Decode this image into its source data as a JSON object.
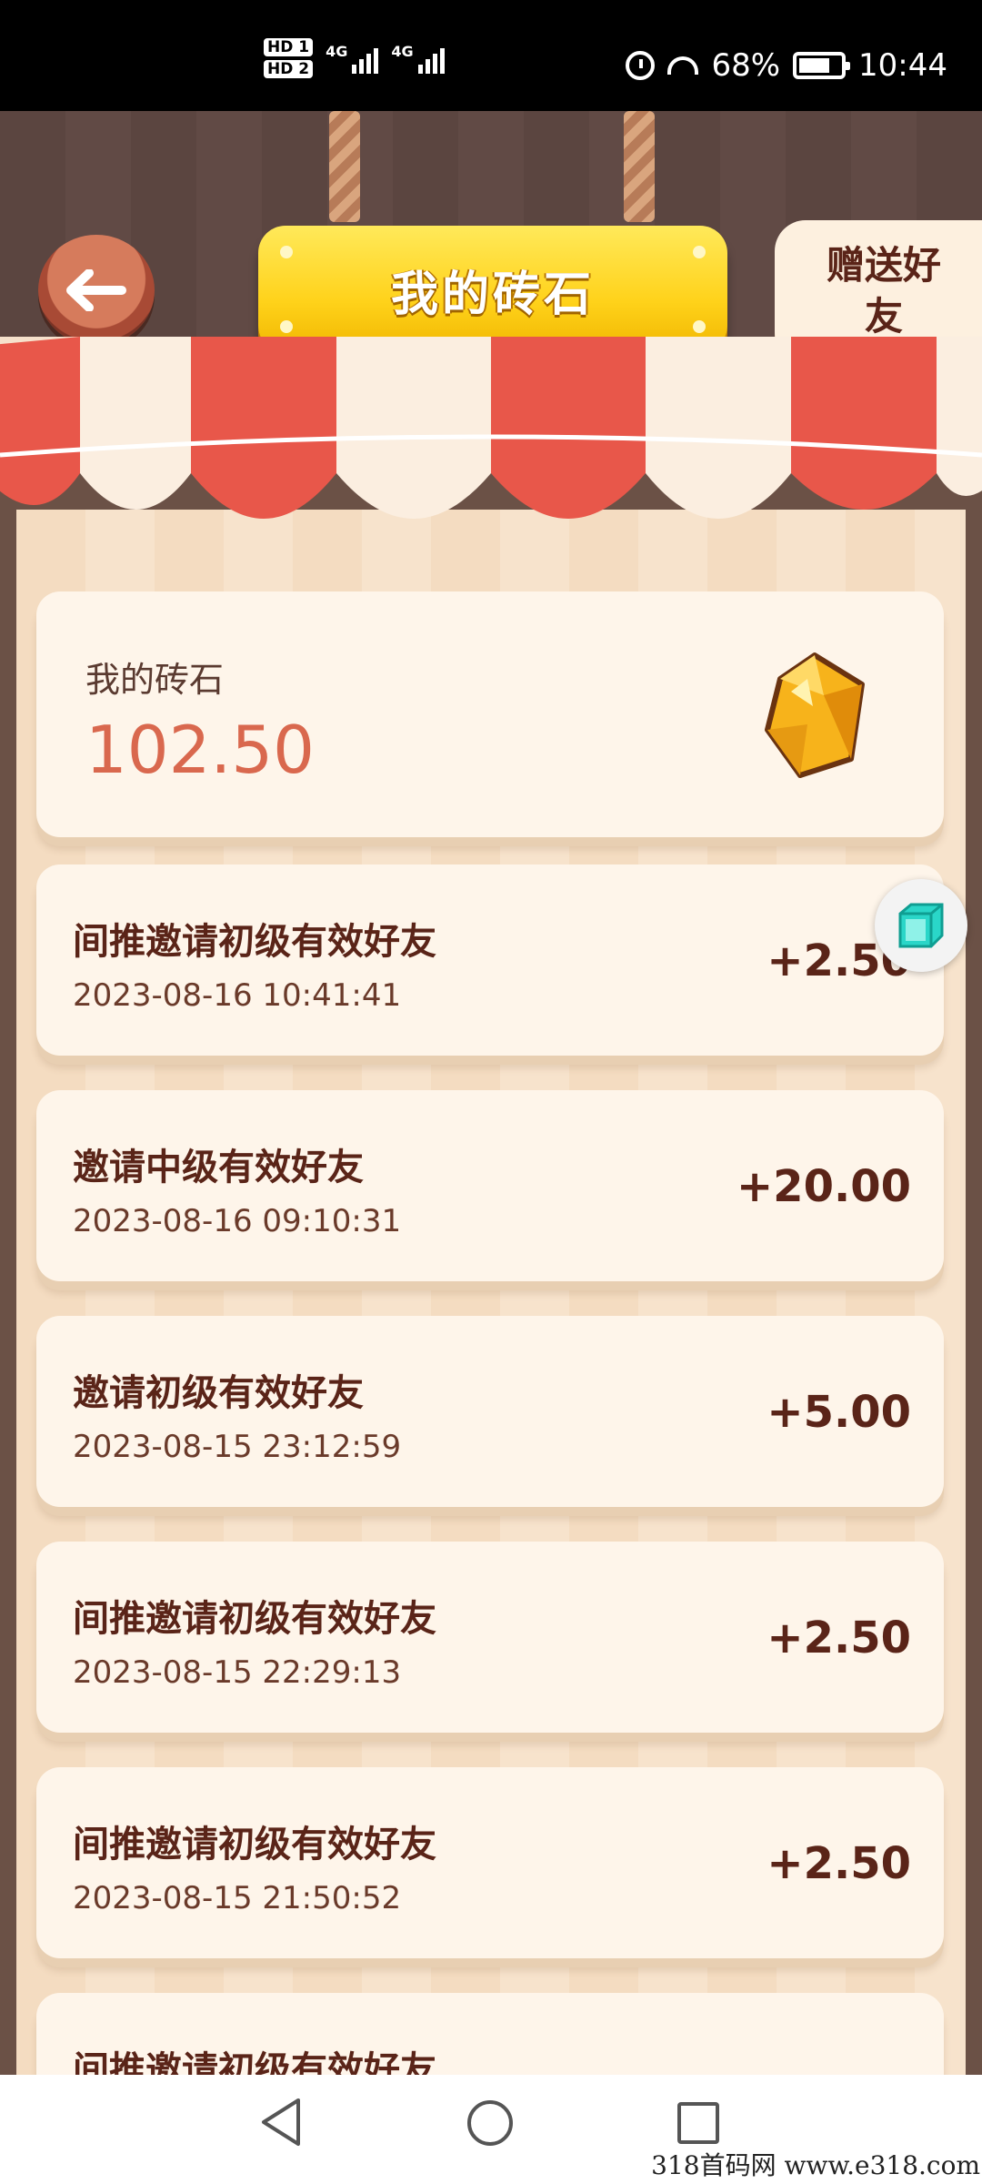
{
  "status_bar": {
    "sim1": "HD 1",
    "sim2": "HD 2",
    "network1": "4G",
    "network2": "4G",
    "battery": "68%",
    "time": "10:44"
  },
  "header": {
    "title": "我的砖石",
    "gift_button": "赠送好友"
  },
  "balance": {
    "label": "我的砖石",
    "value": "102.50"
  },
  "records": [
    {
      "title": "间推邀请初级有效好友",
      "time": "2023-08-16 10:41:41",
      "amount": "+2.50"
    },
    {
      "title": "邀请中级有效好友",
      "time": "2023-08-16 09:10:31",
      "amount": "+20.00"
    },
    {
      "title": "邀请初级有效好友",
      "time": "2023-08-15 23:12:59",
      "amount": "+5.00"
    },
    {
      "title": "间推邀请初级有效好友",
      "time": "2023-08-15 22:29:13",
      "amount": "+2.50"
    },
    {
      "title": "间推邀请初级有效好友",
      "time": "2023-08-15 21:50:52",
      "amount": "+2.50"
    },
    {
      "title": "间推邀请初级有效好友",
      "time": "",
      "amount": ""
    }
  ],
  "watermark": "318首码网  www.e318.com",
  "colors": {
    "accent_orange": "#d9684e",
    "title_yellow": "#ffd21a",
    "text_brown": "#5a2418"
  }
}
